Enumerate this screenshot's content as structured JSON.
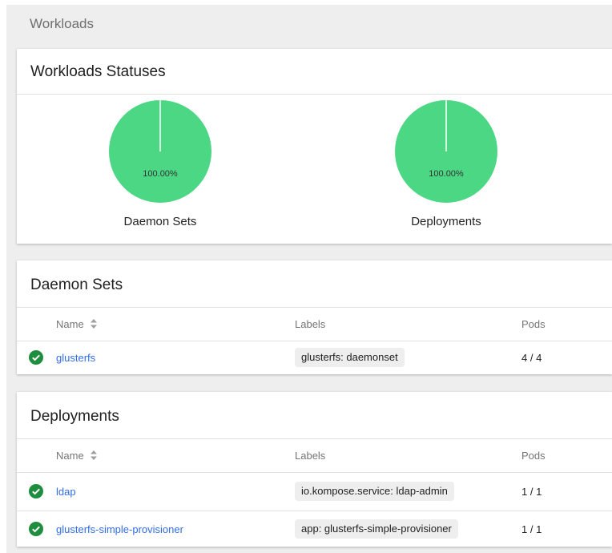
{
  "page": {
    "title": "Workloads"
  },
  "statuses": {
    "title": "Workloads Statuses",
    "charts": [
      {
        "caption": "Daemon Sets",
        "percent_label": "100.00%",
        "running_fraction": 1.0,
        "color": "#4cd784"
      },
      {
        "caption": "Deployments",
        "percent_label": "100.00%",
        "running_fraction": 1.0,
        "color": "#4cd784"
      }
    ]
  },
  "daemon_sets": {
    "title": "Daemon Sets",
    "columns": {
      "name": "Name",
      "labels": "Labels",
      "pods": "Pods"
    },
    "rows": [
      {
        "name": "glusterfs",
        "label": "glusterfs: daemonset",
        "pods": "4 / 4",
        "status": "success"
      }
    ]
  },
  "deployments": {
    "title": "Deployments",
    "columns": {
      "name": "Name",
      "labels": "Labels",
      "pods": "Pods"
    },
    "rows": [
      {
        "name": "ldap",
        "label": "io.kompose.service: ldap-admin",
        "pods": "1 / 1",
        "status": "success"
      },
      {
        "name": "glusterfs-simple-provisioner",
        "label": "app: glusterfs-simple-provisioner",
        "pods": "1 / 1",
        "status": "success"
      }
    ]
  },
  "colors": {
    "success": "#1e8e3e",
    "link": "#326de6",
    "pie": "#4cd784"
  },
  "icons": {
    "status": "check-circle-icon",
    "sort": "sort-icon"
  }
}
